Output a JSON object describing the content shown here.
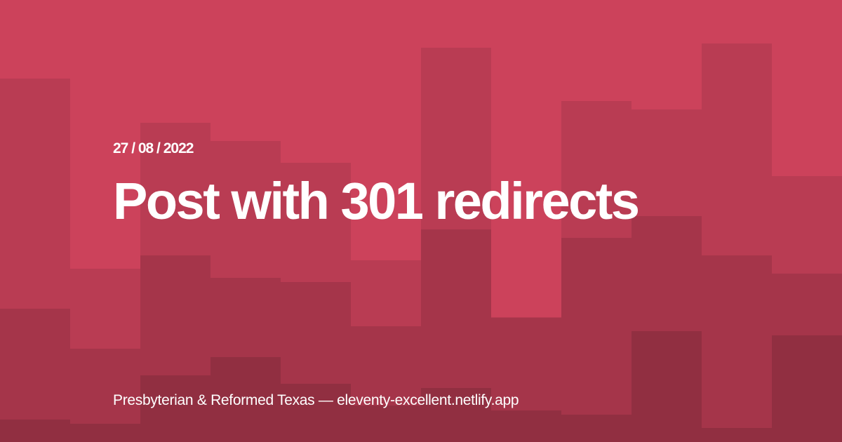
{
  "date": "27 / 08 / 2022",
  "title": "Post with 301 redirects",
  "footer": "Presbyterian & Reformed Texas — eleventy-excellent.netlify.app",
  "colors": {
    "base": "#cc425b",
    "layer1": "#b93c53",
    "layer2": "#a5354a",
    "layer3": "#912f41",
    "text": "#ffffff"
  }
}
